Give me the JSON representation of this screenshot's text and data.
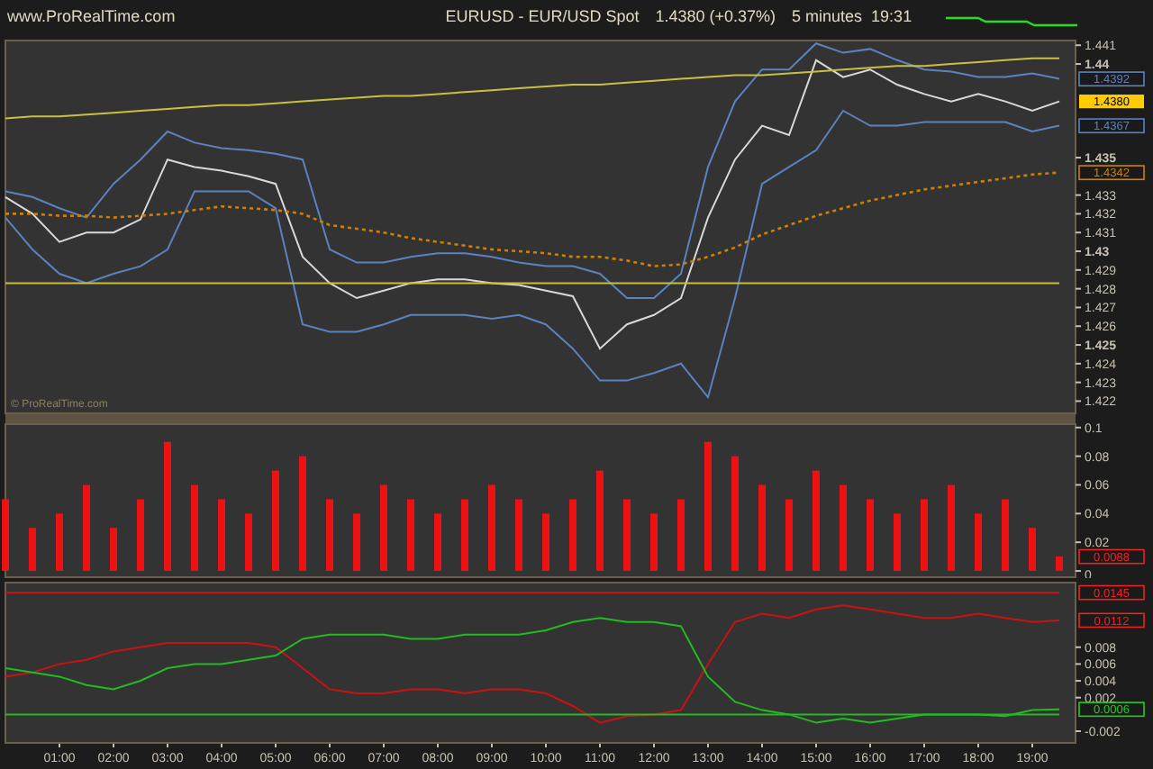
{
  "header": {
    "site": "www.ProRealTime.com",
    "symbol": "EURUSD - EUR/USD Spot",
    "price": "1.4380 (+0.37%)",
    "timeframe": "5 minutes",
    "time": "19:31"
  },
  "price_panel": {
    "credit": "© ProRealTime.com",
    "tags": [
      {
        "text": "1.4392",
        "color": "#5b82c0",
        "kind": "outline"
      },
      {
        "text": "1.4380",
        "color": "#ffcc00",
        "kind": "filled"
      },
      {
        "text": "1.4367",
        "color": "#5b82c0",
        "kind": "outline"
      },
      {
        "text": "1.4342",
        "color": "#d08000",
        "kind": "outline"
      }
    ],
    "chart_data": {
      "type": "line",
      "xlim": [
        0,
        19.8
      ],
      "ylim": [
        1.4213,
        1.4413
      ],
      "x": [
        0,
        0.5,
        1,
        1.5,
        2,
        2.5,
        3,
        3.5,
        4,
        4.5,
        5,
        5.5,
        6,
        6.5,
        7,
        7.5,
        8,
        8.5,
        9,
        9.5,
        10,
        10.5,
        11,
        11.5,
        12,
        12.5,
        13,
        13.5,
        14,
        14.5,
        15,
        15.5,
        16,
        16.5,
        17,
        17.5,
        18,
        18.5,
        19,
        19.5
      ],
      "yticks": [
        {
          "value": 1.441,
          "label": "1.441"
        },
        {
          "value": 1.44,
          "label": "1.44"
        },
        {
          "value": 1.435,
          "label": "1.435"
        },
        {
          "value": 1.433,
          "label": "1.433"
        },
        {
          "value": 1.432,
          "label": "1.432"
        },
        {
          "value": 1.431,
          "label": "1.431"
        },
        {
          "value": 1.43,
          "label": "1.43"
        },
        {
          "value": 1.429,
          "label": "1.429"
        },
        {
          "value": 1.428,
          "label": "1.428"
        },
        {
          "value": 1.427,
          "label": "1.427"
        },
        {
          "value": 1.426,
          "label": "1.426"
        },
        {
          "value": 1.425,
          "label": "1.425"
        },
        {
          "value": 1.424,
          "label": "1.424"
        },
        {
          "value": 1.423,
          "label": "1.423"
        },
        {
          "value": 1.422,
          "label": "1.422"
        }
      ],
      "series": [
        {
          "color": "#5b82c0",
          "values": [
            1.4332,
            1.4329,
            1.4323,
            1.4318,
            1.4336,
            1.4349,
            1.4364,
            1.4358,
            1.4355,
            1.4354,
            1.4352,
            1.4349,
            1.4301,
            1.4294,
            1.4294,
            1.4297,
            1.4299,
            1.4299,
            1.4297,
            1.4294,
            1.4292,
            1.4292,
            1.4288,
            1.4275,
            1.4275,
            1.4288,
            1.4345,
            1.438,
            1.4397,
            1.4397,
            1.4411,
            1.4406,
            1.4408,
            1.4402,
            1.4397,
            1.4396,
            1.4393,
            1.4393,
            1.4395,
            1.4392
          ]
        },
        {
          "color": "#d8d8d8",
          "values": [
            1.4329,
            1.432,
            1.4305,
            1.431,
            1.431,
            1.4317,
            1.4349,
            1.4345,
            1.4343,
            1.434,
            1.4336,
            1.4297,
            1.4283,
            1.4275,
            1.4279,
            1.4283,
            1.4285,
            1.4285,
            1.4283,
            1.4282,
            1.4279,
            1.4276,
            1.4248,
            1.4261,
            1.4266,
            1.4275,
            1.4318,
            1.4349,
            1.4367,
            1.4362,
            1.4402,
            1.4393,
            1.4397,
            1.4389,
            1.4384,
            1.438,
            1.4384,
            1.438,
            1.4375,
            1.438
          ]
        },
        {
          "color": "#5b82c0",
          "values": [
            1.4318,
            1.4301,
            1.4288,
            1.4283,
            1.4288,
            1.4292,
            1.4301,
            1.4332,
            1.4332,
            1.4332,
            1.4323,
            1.4261,
            1.4257,
            1.4257,
            1.4261,
            1.4266,
            1.4266,
            1.4266,
            1.4264,
            1.4266,
            1.4261,
            1.4248,
            1.4231,
            1.4231,
            1.4235,
            1.424,
            1.4222,
            1.4275,
            1.4336,
            1.4345,
            1.4354,
            1.4375,
            1.4367,
            1.4367,
            1.4369,
            1.4369,
            1.4369,
            1.4369,
            1.4364,
            1.4367
          ]
        },
        {
          "color": "#d08000",
          "line_style": "dashed",
          "values": [
            1.432,
            1.432,
            1.4319,
            1.4319,
            1.4318,
            1.4319,
            1.432,
            1.4322,
            1.4324,
            1.4323,
            1.4322,
            1.432,
            1.4314,
            1.4312,
            1.431,
            1.4307,
            1.4305,
            1.4303,
            1.4301,
            1.43,
            1.4299,
            1.4297,
            1.4297,
            1.4295,
            1.4292,
            1.4293,
            1.4297,
            1.4302,
            1.4309,
            1.4314,
            1.4319,
            1.4323,
            1.4327,
            1.433,
            1.4333,
            1.4335,
            1.4337,
            1.4339,
            1.4341,
            1.4342
          ]
        },
        {
          "color": "#c8c040",
          "values": [
            1.4371,
            1.4372,
            1.4372,
            1.4373,
            1.4374,
            1.4375,
            1.4376,
            1.4377,
            1.4378,
            1.4378,
            1.4379,
            1.438,
            1.4381,
            1.4382,
            1.4383,
            1.4383,
            1.4384,
            1.4385,
            1.4386,
            1.4387,
            1.4388,
            1.4389,
            1.4389,
            1.439,
            1.4391,
            1.4392,
            1.4393,
            1.4394,
            1.4394,
            1.4395,
            1.4396,
            1.4397,
            1.4398,
            1.4399,
            1.4399,
            1.44,
            1.4401,
            1.4402,
            1.4403,
            1.4403
          ]
        },
        {
          "color": "#c8c040",
          "values": [
            1.4283,
            1.4283,
            1.4283,
            1.4283,
            1.4283,
            1.4283,
            1.4283,
            1.4283,
            1.4283,
            1.4283,
            1.4283,
            1.4283,
            1.4283,
            1.4283,
            1.4283,
            1.4283,
            1.4283,
            1.4283,
            1.4283,
            1.4283,
            1.4283,
            1.4283,
            1.4283,
            1.4283,
            1.4283,
            1.4283,
            1.4283,
            1.4283,
            1.4283,
            1.4283,
            1.4283,
            1.4283,
            1.4283,
            1.4283,
            1.4283,
            1.4283,
            1.4283,
            1.4283,
            1.4283,
            1.4283
          ]
        }
      ]
    }
  },
  "volume_panel": {
    "tags": [
      {
        "text": "0.0088",
        "color": "#ee2222",
        "kind": "outline"
      }
    ],
    "chart_data": {
      "type": "bar",
      "xlim": [
        0,
        19.8
      ],
      "ylim": [
        -0.005,
        0.103
      ],
      "x": [
        0,
        0.5,
        1,
        1.5,
        2,
        2.5,
        3,
        3.5,
        4,
        4.5,
        5,
        5.5,
        6,
        6.5,
        7,
        7.5,
        8,
        8.5,
        9,
        9.5,
        10,
        10.5,
        11,
        11.5,
        12,
        12.5,
        13,
        13.5,
        14,
        14.5,
        15,
        15.5,
        16,
        16.5,
        17,
        17.5,
        18,
        18.5,
        19,
        19.5
      ],
      "yticks": [
        {
          "value": 0.1,
          "label": "0.1"
        },
        {
          "value": 0.08,
          "label": "0.08"
        },
        {
          "value": 0.06,
          "label": "0.06"
        },
        {
          "value": 0.04,
          "label": "0.04"
        },
        {
          "value": 0.02,
          "label": "0.02"
        },
        {
          "value": 0,
          "label": "0"
        }
      ],
      "series": [
        {
          "color": "#ee1111",
          "values": [
            0.05,
            0.03,
            0.04,
            0.06,
            0.03,
            0.05,
            0.09,
            0.06,
            0.05,
            0.04,
            0.07,
            0.08,
            0.05,
            0.04,
            0.06,
            0.05,
            0.04,
            0.05,
            0.06,
            0.05,
            0.04,
            0.05,
            0.07,
            0.05,
            0.04,
            0.05,
            0.09,
            0.08,
            0.06,
            0.05,
            0.07,
            0.06,
            0.05,
            0.04,
            0.05,
            0.06,
            0.04,
            0.05,
            0.03,
            0.01
          ]
        }
      ]
    }
  },
  "indicator_panel": {
    "tags": [
      {
        "text": "0.0145",
        "color": "#ee2222",
        "kind": "outline"
      },
      {
        "text": "0.0112",
        "color": "#ee2222",
        "kind": "outline"
      },
      {
        "text": "0.0006",
        "color": "#22cc22",
        "kind": "outline"
      }
    ],
    "chart_data": {
      "type": "line",
      "xlim": [
        0,
        19.8
      ],
      "ylim": [
        -0.0035,
        0.0158
      ],
      "x": [
        0,
        0.5,
        1,
        1.5,
        2,
        2.5,
        3,
        3.5,
        4,
        4.5,
        5,
        5.5,
        6,
        6.5,
        7,
        7.5,
        8,
        8.5,
        9,
        9.5,
        10,
        10.5,
        11,
        11.5,
        12,
        12.5,
        13,
        13.5,
        14,
        14.5,
        15,
        15.5,
        16,
        16.5,
        17,
        17.5,
        18,
        18.5,
        19,
        19.5
      ],
      "xticks": [
        {
          "value": 1,
          "label": "01:00"
        },
        {
          "value": 2,
          "label": "02:00"
        },
        {
          "value": 3,
          "label": "03:00"
        },
        {
          "value": 4,
          "label": "04:00"
        },
        {
          "value": 5,
          "label": "05:00"
        },
        {
          "value": 6,
          "label": "06:00"
        },
        {
          "value": 7,
          "label": "07:00"
        },
        {
          "value": 8,
          "label": "08:00"
        },
        {
          "value": 9,
          "label": "09:00"
        },
        {
          "value": 10,
          "label": "10:00"
        },
        {
          "value": 11,
          "label": "11:00"
        },
        {
          "value": 12,
          "label": "12:00"
        },
        {
          "value": 13,
          "label": "13:00"
        },
        {
          "value": 14,
          "label": "14:00"
        },
        {
          "value": 15,
          "label": "15:00"
        },
        {
          "value": 16,
          "label": "16:00"
        },
        {
          "value": 17,
          "label": "17:00"
        },
        {
          "value": 18,
          "label": "18:00"
        },
        {
          "value": 19,
          "label": "19:00"
        }
      ],
      "yticks": [
        {
          "value": 0.008,
          "label": "0.008"
        },
        {
          "value": 0.006,
          "label": "0.006"
        },
        {
          "value": 0.004,
          "label": "0.004"
        },
        {
          "value": 0.002,
          "label": "0.002"
        },
        {
          "value": -0.002,
          "label": "-0.002"
        }
      ],
      "series": [
        {
          "color": "#cc1111",
          "values": [
            0.0145,
            0.0145,
            0.0145,
            0.0145,
            0.0145,
            0.0145,
            0.0145,
            0.0145,
            0.0145,
            0.0145,
            0.0145,
            0.0145,
            0.0145,
            0.0145,
            0.0145,
            0.0145,
            0.0145,
            0.0145,
            0.0145,
            0.0145,
            0.0145,
            0.0145,
            0.0145,
            0.0145,
            0.0145,
            0.0145,
            0.0145,
            0.0145,
            0.0145,
            0.0145,
            0.0145,
            0.0145,
            0.0145,
            0.0145,
            0.0145,
            0.0145,
            0.0145,
            0.0145,
            0.0145,
            0.0145
          ]
        },
        {
          "color": "#cc1111",
          "values": [
            0.0045,
            0.005,
            0.006,
            0.0065,
            0.0075,
            0.008,
            0.0085,
            0.0085,
            0.0085,
            0.0085,
            0.008,
            0.0055,
            0.003,
            0.0025,
            0.0025,
            0.003,
            0.003,
            0.0025,
            0.003,
            0.003,
            0.0025,
            0.001,
            -0.001,
            -0.0002,
            0,
            0.0005,
            0.006,
            0.011,
            0.012,
            0.0115,
            0.0125,
            0.013,
            0.0125,
            0.012,
            0.0115,
            0.0115,
            0.012,
            0.0115,
            0.011,
            0.0112
          ]
        },
        {
          "color": "#22bb22",
          "values": [
            0.0055,
            0.005,
            0.0045,
            0.0035,
            0.003,
            0.004,
            0.0055,
            0.006,
            0.006,
            0.0065,
            0.007,
            0.009,
            0.0095,
            0.0095,
            0.0095,
            0.009,
            0.009,
            0.0095,
            0.0095,
            0.0095,
            0.01,
            0.011,
            0.0115,
            0.011,
            0.011,
            0.0105,
            0.0045,
            0.0015,
            0.0005,
            0,
            -0.001,
            -0.0005,
            -0.001,
            -0.0005,
            0,
            0,
            0,
            -0.0002,
            0.0005,
            0.0006
          ]
        },
        {
          "color": "#22bb22",
          "values": [
            0,
            0,
            0,
            0,
            0,
            0,
            0,
            0,
            0,
            0,
            0,
            0,
            0,
            0,
            0,
            0,
            0,
            0,
            0,
            0,
            0,
            0,
            0,
            0,
            0,
            0,
            0,
            0,
            0,
            0,
            0,
            0,
            0,
            0,
            0,
            0,
            0,
            0,
            0,
            0
          ]
        }
      ]
    }
  }
}
